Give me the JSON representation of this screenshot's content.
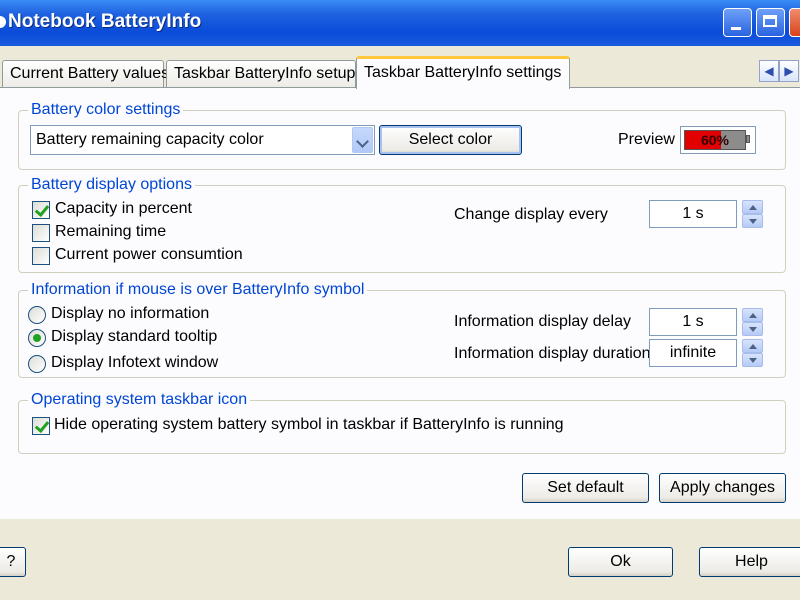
{
  "window": {
    "title": "Notebook BatteryInfo"
  },
  "tabs": [
    {
      "label": "Current Battery values"
    },
    {
      "label": "Taskbar BatteryInfo setup"
    },
    {
      "label": "Taskbar BatteryInfo settings"
    }
  ],
  "color_settings": {
    "legend": "Battery color settings",
    "select_value": "Battery remaining capacity color",
    "select_color_label": "Select color",
    "preview_label": "Preview",
    "preview_percent_text": "60%",
    "preview_level": 0.6,
    "preview_color": "#E20000"
  },
  "display_options": {
    "legend": "Battery display options",
    "capacity_in_percent": {
      "label": "Capacity in percent",
      "checked": true
    },
    "remaining_time": {
      "label": "Remaining time",
      "checked": false
    },
    "power_consumption": {
      "label": "Current power consumtion",
      "checked": false
    },
    "change_display_label": "Change display every",
    "change_display_value": "1 s"
  },
  "mouse_info": {
    "legend": "Information if mouse is over BatteryInfo symbol",
    "opt_no_info": "Display no information",
    "opt_standard_tooltip": "Display standard tooltip",
    "opt_infotext_window": "Display Infotext window",
    "selected": "Display standard tooltip",
    "delay_label": "Information display delay",
    "delay_value": "1 s",
    "duration_label": "Information display duration",
    "duration_value": "infinite"
  },
  "taskbar_icon": {
    "legend": "Operating system taskbar icon",
    "hide_label": "Hide operating system battery symbol in taskbar if BatteryInfo is running",
    "checked": true
  },
  "actions": {
    "set_default": "Set default",
    "apply_changes": "Apply changes"
  },
  "footer": {
    "help_q": "?",
    "ok": "Ok",
    "help": "Help"
  },
  "colors": {
    "title_bar": "#0A4CD8",
    "group_legend": "#0046D5",
    "active_tab_highlight": "#FFC83C",
    "check_mark": "#21A121"
  }
}
